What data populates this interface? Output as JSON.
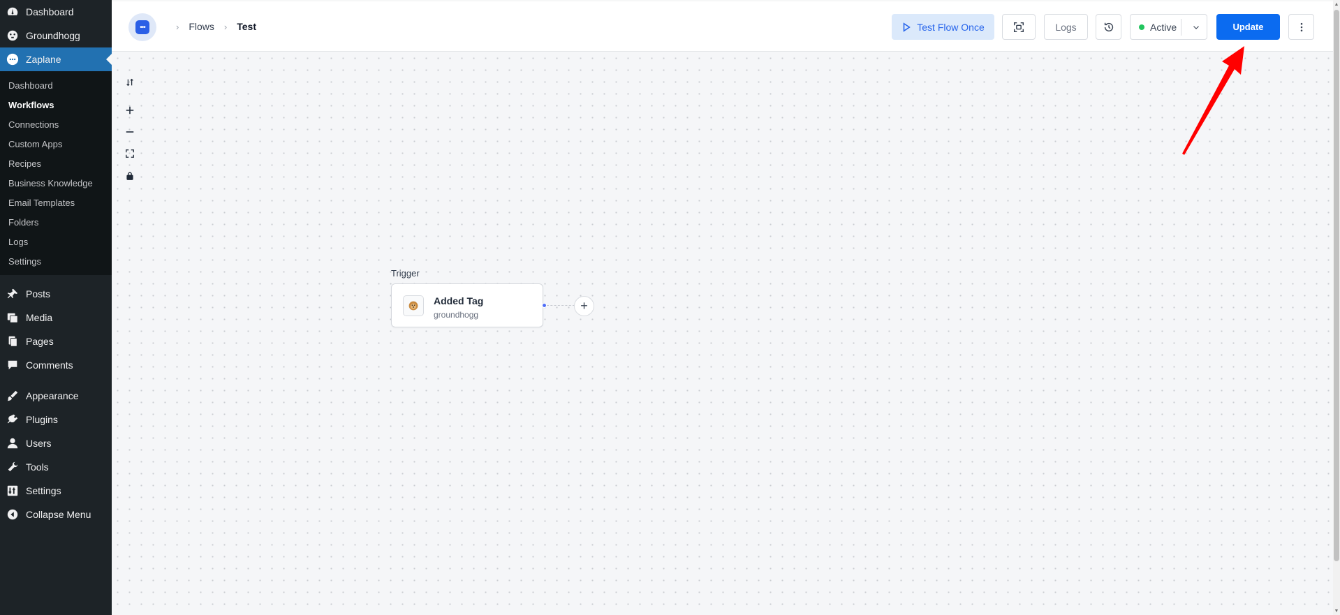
{
  "sidebar": {
    "top_items": [
      {
        "label": "Dashboard",
        "icon": "dashboard-icon"
      },
      {
        "label": "Groundhogg",
        "icon": "groundhogg-icon"
      },
      {
        "label": "Zaplane",
        "icon": "zaplane-icon"
      }
    ],
    "submenu": [
      "Dashboard",
      "Workflows",
      "Connections",
      "Custom Apps",
      "Recipes",
      "Business Knowledge",
      "Email Templates",
      "Folders",
      "Logs",
      "Settings"
    ],
    "current_submenu": "Workflows",
    "items": [
      {
        "label": "Posts",
        "icon": "pin-icon"
      },
      {
        "label": "Media",
        "icon": "media-icon"
      },
      {
        "label": "Pages",
        "icon": "pages-icon"
      },
      {
        "label": "Comments",
        "icon": "comment-icon"
      },
      {
        "label": "Appearance",
        "icon": "brush-icon"
      },
      {
        "label": "Plugins",
        "icon": "plugin-icon"
      },
      {
        "label": "Users",
        "icon": "user-icon"
      },
      {
        "label": "Tools",
        "icon": "wrench-icon"
      },
      {
        "label": "Settings",
        "icon": "settings-icon"
      },
      {
        "label": "Collapse Menu",
        "icon": "collapse-icon"
      }
    ]
  },
  "header": {
    "breadcrumb": {
      "parent": "Flows",
      "current": "Test"
    },
    "test_flow_label": "Test Flow Once",
    "logs_label": "Logs",
    "status_label": "Active",
    "update_label": "Update"
  },
  "canvas": {
    "trigger_label": "Trigger",
    "node": {
      "title": "Added Tag",
      "subtitle": "groundhogg"
    }
  },
  "colors": {
    "sidebar_bg": "#1d2327",
    "accent": "#2271b1",
    "update_button": "#0b6bf0",
    "status_dot": "#22c55e",
    "annotation_arrow": "#ff0000"
  }
}
